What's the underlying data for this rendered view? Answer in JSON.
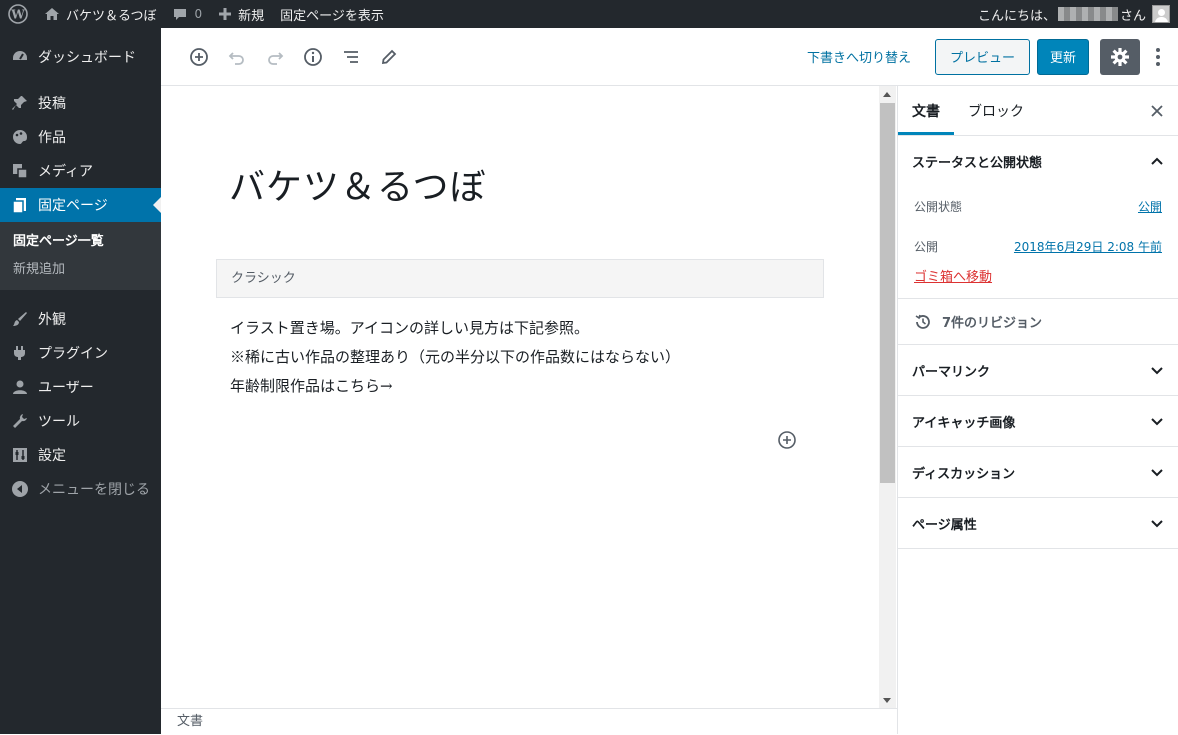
{
  "adminbar": {
    "site_name": "バケツ＆るつぼ",
    "comments_count": "0",
    "new_label": "新規",
    "view_page_label": "固定ページを表示",
    "greeting": "こんにちは、",
    "greeting_suffix": "さん"
  },
  "sidebar": {
    "dashboard": "ダッシュボード",
    "posts": "投稿",
    "works": "作品",
    "media": "メディア",
    "pages": "固定ページ",
    "pages_sub": [
      "固定ページ一覧",
      "新規追加"
    ],
    "appearance": "外観",
    "plugins": "プラグイン",
    "users": "ユーザー",
    "tools": "ツール",
    "settings": "設定",
    "collapse": "メニューを閉じる"
  },
  "header": {
    "switch_to_draft": "下書きへ切り替え",
    "preview": "プレビュー",
    "update": "更新"
  },
  "content": {
    "title": "バケツ＆るつぼ",
    "classic_label": "クラシック",
    "lines": [
      "イラスト置き場。アイコンの詳しい見方は下記参照。",
      "※稀に古い作品の整理あり（元の半分以下の作品数にはならない）",
      "年齢制限作品はこちら→"
    ]
  },
  "footer": {
    "breadcrumb": "文書"
  },
  "settings_panel": {
    "tabs": [
      "文書",
      "ブロック"
    ],
    "status_panel_title": "ステータスと公開状態",
    "visibility_label": "公開状態",
    "visibility_value": "公開",
    "publish_label": "公開",
    "publish_value": "2018年6月29日 2:08 午前",
    "trash_label": "ゴミ箱へ移動",
    "revisions": "7件のリビジョン",
    "panels": [
      "パーマリンク",
      "アイキャッチ画像",
      "ディスカッション",
      "ページ属性"
    ]
  },
  "colors": {
    "adminbar": "#23282d",
    "accent": "#0085ba",
    "link": "#0073aa",
    "danger": "#dc3232"
  }
}
